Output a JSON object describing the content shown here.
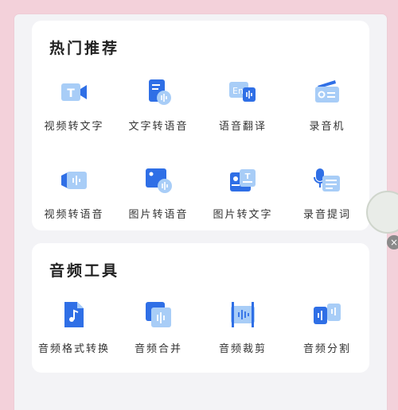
{
  "sections": [
    {
      "title": "热门推荐",
      "items": [
        {
          "label": "视频转文字",
          "icon": "video-to-text-icon"
        },
        {
          "label": "文字转语音",
          "icon": "text-to-speech-icon"
        },
        {
          "label": "语音翻译",
          "icon": "voice-translate-icon"
        },
        {
          "label": "录音机",
          "icon": "recorder-icon"
        },
        {
          "label": "视频转语音",
          "icon": "video-to-audio-icon"
        },
        {
          "label": "图片转语音",
          "icon": "image-to-speech-icon"
        },
        {
          "label": "图片转文字",
          "icon": "image-to-text-icon"
        },
        {
          "label": "录音提词",
          "icon": "teleprompter-icon"
        }
      ]
    },
    {
      "title": "音频工具",
      "items": [
        {
          "label": "音频格式转换",
          "icon": "audio-format-convert-icon"
        },
        {
          "label": "音频合并",
          "icon": "audio-merge-icon"
        },
        {
          "label": "音频裁剪",
          "icon": "audio-cut-icon"
        },
        {
          "label": "音频分割",
          "icon": "audio-split-icon"
        }
      ]
    }
  ],
  "floating_close": "×",
  "colors": {
    "accent_dark": "#2f6fe6",
    "accent_light": "#a8cdf7",
    "background": "#f3d1da"
  }
}
